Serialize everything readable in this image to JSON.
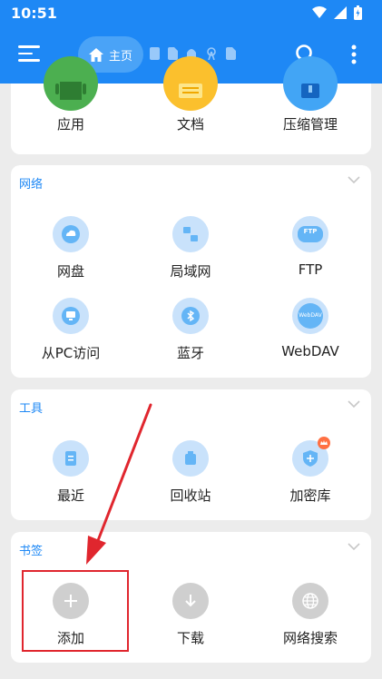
{
  "status_bar": {
    "time": "10:51"
  },
  "header": {
    "home_label": "主页"
  },
  "top_section": {
    "items": [
      {
        "label": "应用",
        "color": "#4caf50"
      },
      {
        "label": "文档",
        "color": "#fbc02d"
      },
      {
        "label": "压缩管理",
        "color": "#42a5f5"
      }
    ]
  },
  "network": {
    "title": "网络",
    "items": [
      {
        "label": "网盘",
        "icon": "cloud-icon"
      },
      {
        "label": "局域网",
        "icon": "lan-icon"
      },
      {
        "label": "FTP",
        "icon": "ftp-icon",
        "icon_text": "FTP"
      },
      {
        "label": "从PC访问",
        "icon": "monitor-icon"
      },
      {
        "label": "蓝牙",
        "icon": "bluetooth-icon"
      },
      {
        "label": "WebDAV",
        "icon": "webdav-icon",
        "icon_text": "WebDAV"
      }
    ]
  },
  "tools": {
    "title": "工具",
    "items": [
      {
        "label": "最近",
        "icon": "recent-icon"
      },
      {
        "label": "回收站",
        "icon": "recycle-bin-icon"
      },
      {
        "label": "加密库",
        "icon": "vault-icon"
      }
    ]
  },
  "bookmarks": {
    "title": "书签",
    "items": [
      {
        "label": "添加",
        "icon": "plus-icon"
      },
      {
        "label": "下载",
        "icon": "download-icon"
      },
      {
        "label": "网络搜索",
        "icon": "globe-icon"
      }
    ]
  },
  "colors": {
    "accent": "#1e88f5",
    "highlight": "#e0262e"
  }
}
